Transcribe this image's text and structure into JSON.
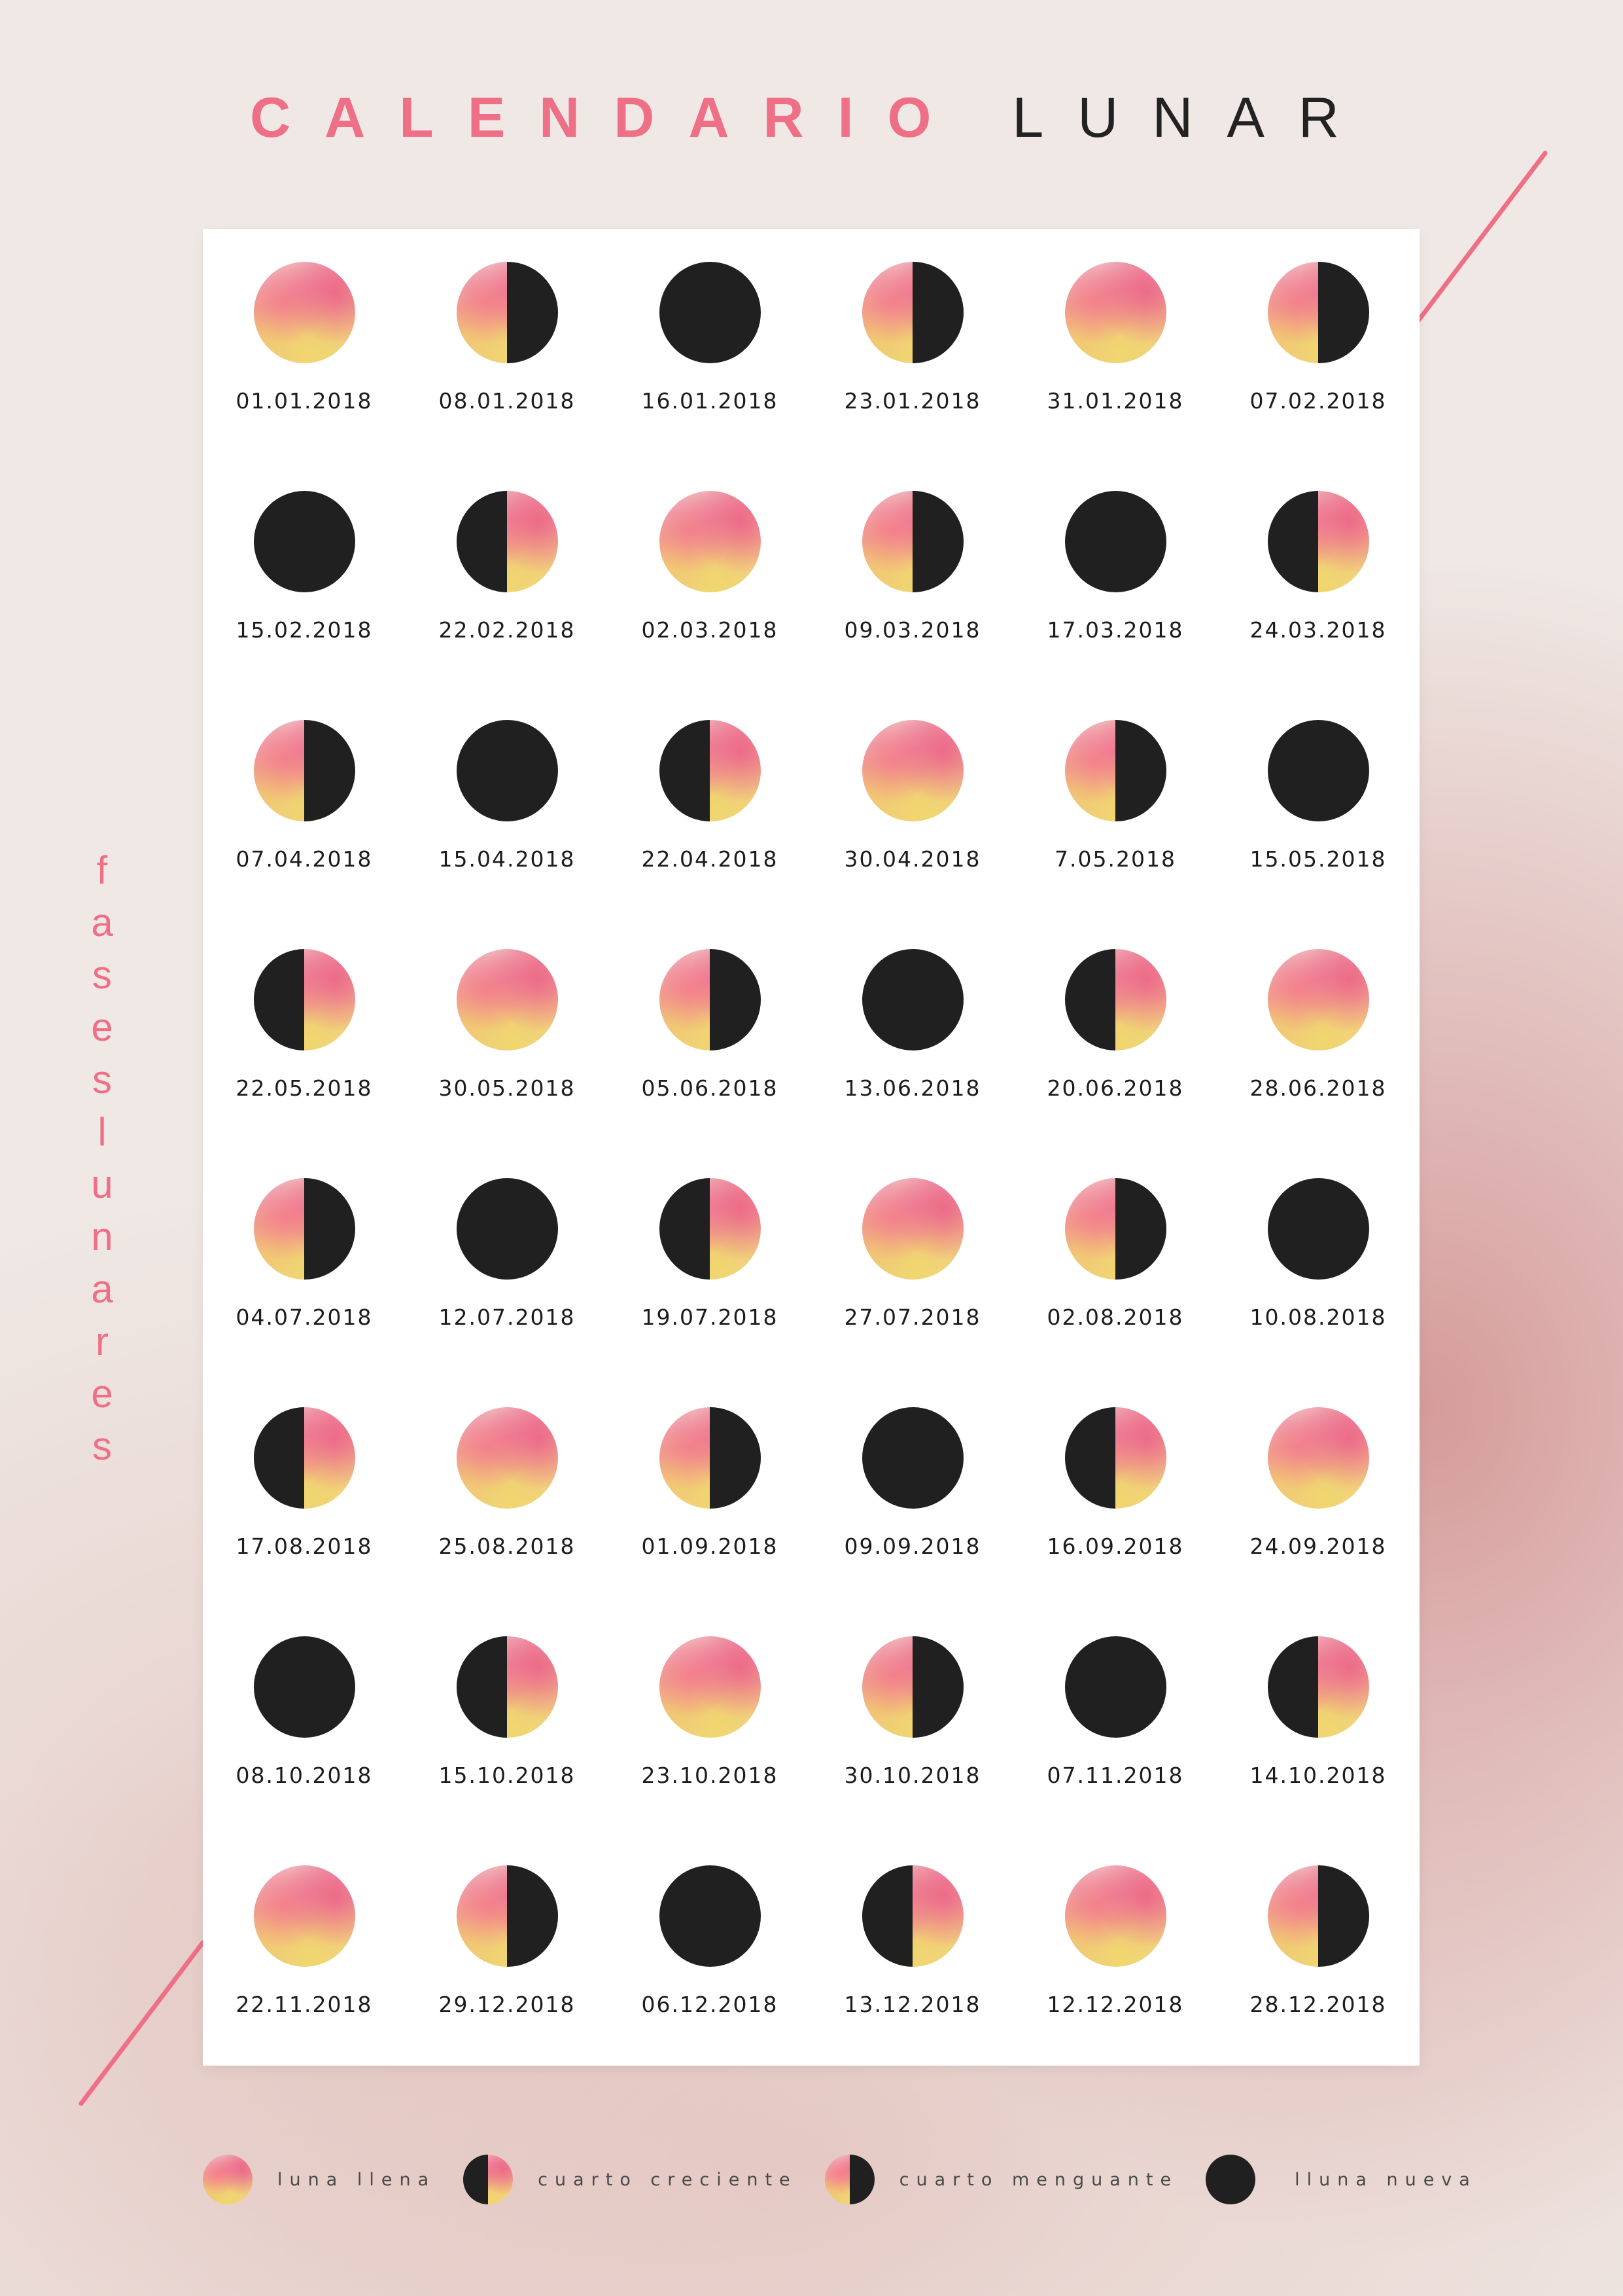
{
  "title": {
    "part1": "CALENDARIO",
    "part2": "LUNAR"
  },
  "side_text": [
    "f",
    "a",
    "s",
    "e",
    "s",
    "l",
    "u",
    "n",
    "a",
    "r",
    "e",
    "s"
  ],
  "colors": {
    "accent": "#ef6f86",
    "dark": "#202020",
    "panel": "#ffffff"
  },
  "phases": [
    {
      "type": "full",
      "date": "01.01.2018"
    },
    {
      "type": "waxing",
      "date": "08.01.2018"
    },
    {
      "type": "new",
      "date": "16.01.2018"
    },
    {
      "type": "waxing",
      "date": "23.01.2018"
    },
    {
      "type": "full",
      "date": "31.01.2018"
    },
    {
      "type": "waxing",
      "date": "07.02.2018"
    },
    {
      "type": "new",
      "date": "15.02.2018"
    },
    {
      "type": "waning",
      "date": "22.02.2018"
    },
    {
      "type": "full",
      "date": "02.03.2018"
    },
    {
      "type": "waxing",
      "date": "09.03.2018"
    },
    {
      "type": "new",
      "date": "17.03.2018"
    },
    {
      "type": "waning",
      "date": "24.03.2018"
    },
    {
      "type": "waxing",
      "date": "07.04.2018"
    },
    {
      "type": "new",
      "date": "15.04.2018"
    },
    {
      "type": "waning",
      "date": "22.04.2018"
    },
    {
      "type": "full",
      "date": "30.04.2018"
    },
    {
      "type": "waxing",
      "date": "7.05.2018"
    },
    {
      "type": "new",
      "date": "15.05.2018"
    },
    {
      "type": "waning",
      "date": "22.05.2018"
    },
    {
      "type": "full",
      "date": "30.05.2018"
    },
    {
      "type": "waxing",
      "date": "05.06.2018"
    },
    {
      "type": "new",
      "date": "13.06.2018"
    },
    {
      "type": "waning",
      "date": "20.06.2018"
    },
    {
      "type": "full",
      "date": "28.06.2018"
    },
    {
      "type": "waxing",
      "date": "04.07.2018"
    },
    {
      "type": "new",
      "date": "12.07.2018"
    },
    {
      "type": "waning",
      "date": "19.07.2018"
    },
    {
      "type": "full",
      "date": "27.07.2018"
    },
    {
      "type": "waxing",
      "date": "02.08.2018"
    },
    {
      "type": "new",
      "date": "10.08.2018"
    },
    {
      "type": "waning",
      "date": "17.08.2018"
    },
    {
      "type": "full",
      "date": "25.08.2018"
    },
    {
      "type": "waxing",
      "date": "01.09.2018"
    },
    {
      "type": "new",
      "date": "09.09.2018"
    },
    {
      "type": "waning",
      "date": "16.09.2018"
    },
    {
      "type": "full",
      "date": "24.09.2018"
    },
    {
      "type": "new",
      "date": "08.10.2018"
    },
    {
      "type": "waning",
      "date": "15.10.2018"
    },
    {
      "type": "full",
      "date": "23.10.2018"
    },
    {
      "type": "waxing",
      "date": "30.10.2018"
    },
    {
      "type": "new",
      "date": "07.11.2018"
    },
    {
      "type": "waning",
      "date": "14.10.2018"
    },
    {
      "type": "full",
      "date": "22.11.2018"
    },
    {
      "type": "waxing",
      "date": "29.12.2018"
    },
    {
      "type": "new",
      "date": "06.12.2018"
    },
    {
      "type": "waning",
      "date": "13.12.2018"
    },
    {
      "type": "full",
      "date": "12.12.2018"
    },
    {
      "type": "waxing",
      "date": "28.12.2018"
    }
  ],
  "legend": [
    {
      "type": "full",
      "label": "luna llena"
    },
    {
      "type": "waning",
      "label": "cuarto creciente"
    },
    {
      "type": "waxing",
      "label": "cuarto menguante"
    },
    {
      "type": "new",
      "label": "lluna nueva"
    }
  ]
}
